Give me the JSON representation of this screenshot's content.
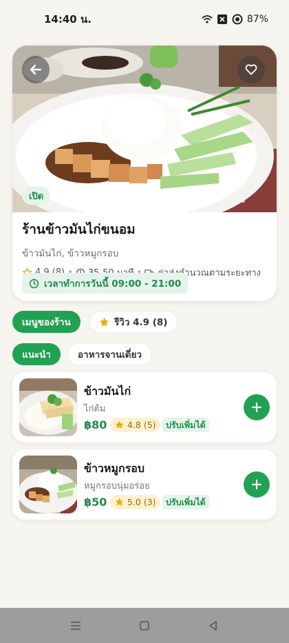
{
  "status": {
    "time": "14:40 น.",
    "battery": "87%"
  },
  "restaurant": {
    "open_label": "เปิด",
    "name": "ร้านข้าวมันไก่ขนอม",
    "categories": "ข้าวมันไก่, ข้าวหมูกรอบ",
    "rating": "4.9 (8)",
    "delivery_time": "35-50 นาที",
    "delivery_fee": "ค่าส่งคำนวณตามระยะทาง",
    "hours": "เวลาทำการวันนี้ 09:00 - 21:00"
  },
  "tabs": {
    "menu": "เมนูของร้าน",
    "reviews": "รีวิว 4.9 (8)"
  },
  "filters": {
    "recommended": "แนะนำ",
    "single_dish": "อาหารจานเดี่ยว"
  },
  "menu_items": [
    {
      "name": "ข้าวมันไก่",
      "description": "ไก่ต้ม",
      "price": "฿80",
      "rating": "4.8 (5)",
      "tag": "ปรับเพิ่มได้"
    },
    {
      "name": "ข้าวหมูกรอบ",
      "description": "หมูกรอบนุ่มอร่อย",
      "price": "฿50",
      "rating": "5.0 (3)",
      "tag": "ปรับเพิ่มได้"
    }
  ],
  "icons": {
    "back": "arrow-left-icon",
    "favorite": "heart-icon",
    "rating": "star-icon",
    "time": "clock-icon",
    "delivery": "truck-icon",
    "hours": "clock-icon",
    "add": "plus-icon"
  },
  "colors": {
    "brand_green": "#21a152",
    "text_green": "#1e8a4f",
    "star": "#f5a800",
    "background": "#f7f5ef"
  }
}
